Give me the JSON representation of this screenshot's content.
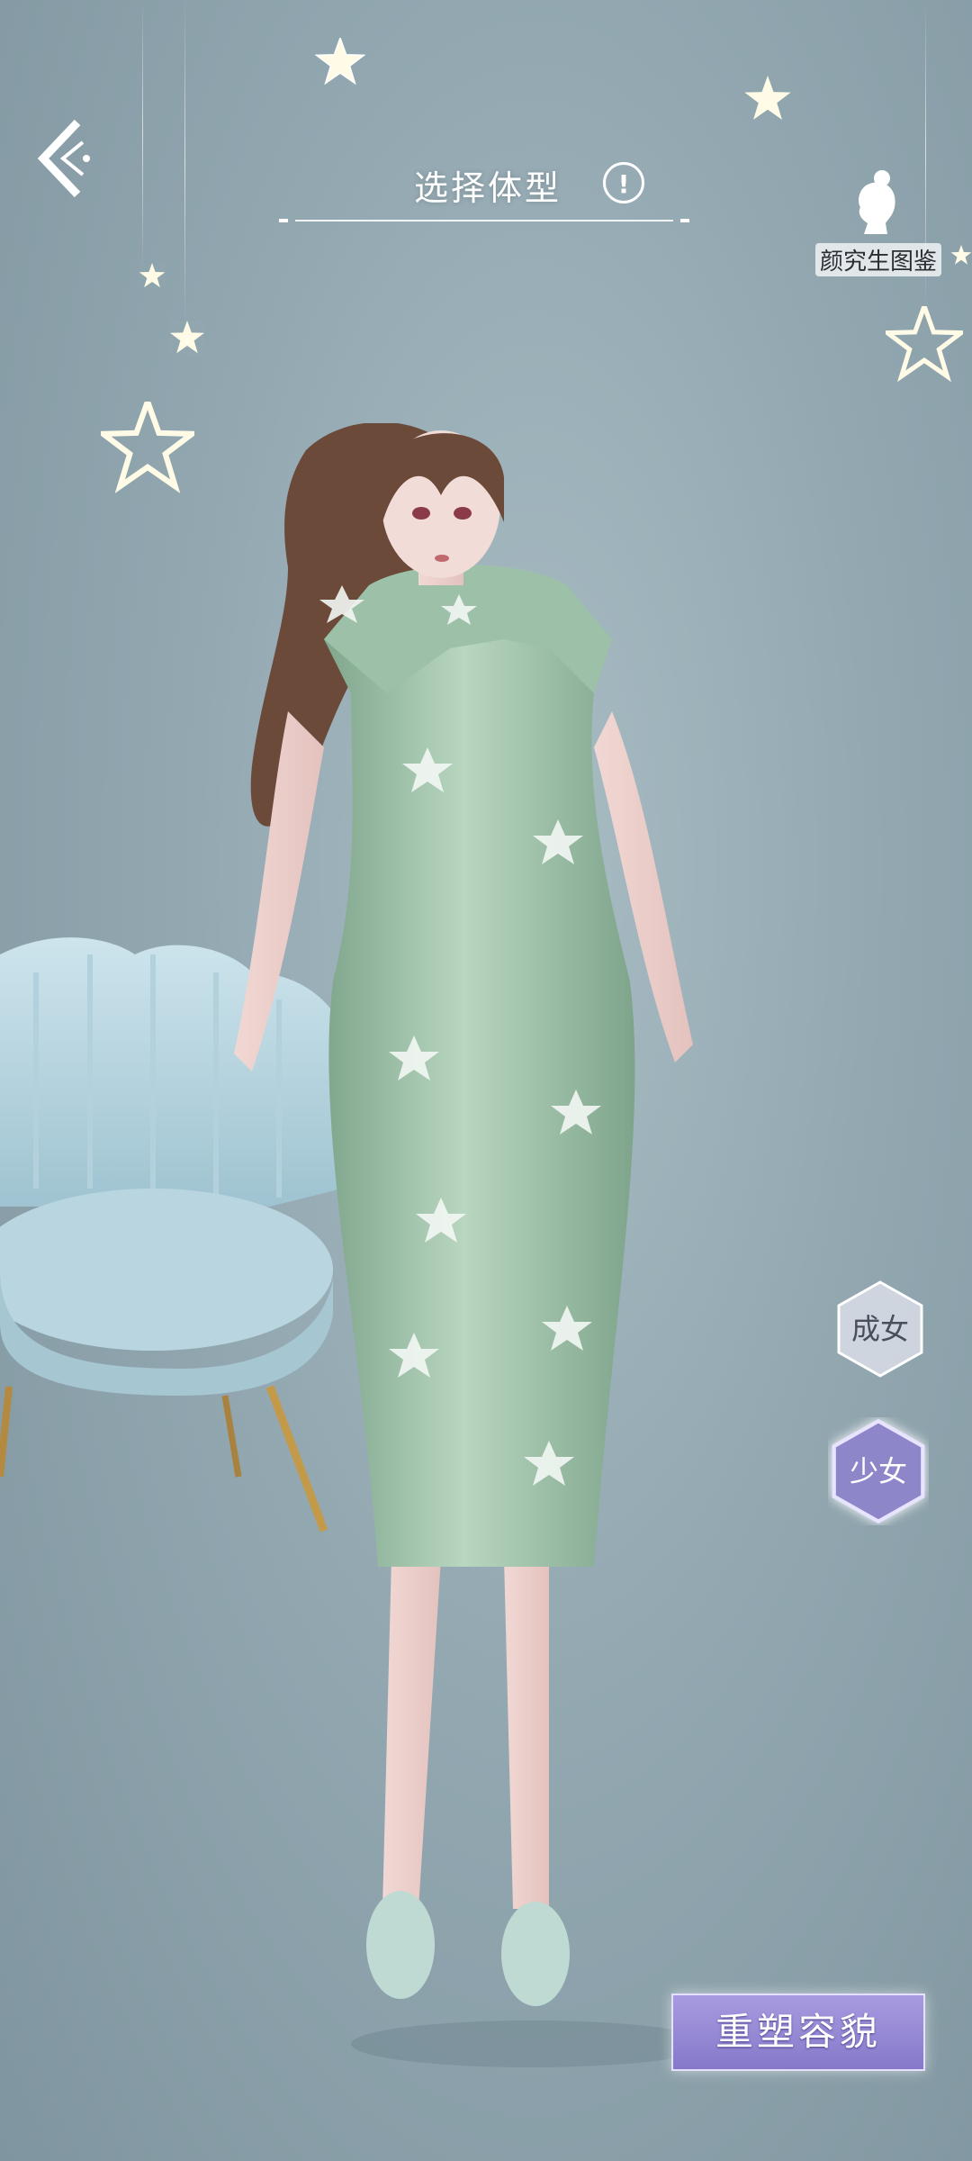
{
  "header": {
    "title": "选择体型",
    "info_symbol": "!",
    "guide_label": "颜究生图鉴"
  },
  "body_types": [
    {
      "label": "成女",
      "selected": false
    },
    {
      "label": "少女",
      "selected": true
    }
  ],
  "primary_action": {
    "label": "重塑容貌"
  },
  "character": {
    "outfit_color": "#8fb59c",
    "hair_color": "#6b4a3a"
  },
  "colors": {
    "accent": "#8a7fd0",
    "background": "#93a8b1"
  }
}
